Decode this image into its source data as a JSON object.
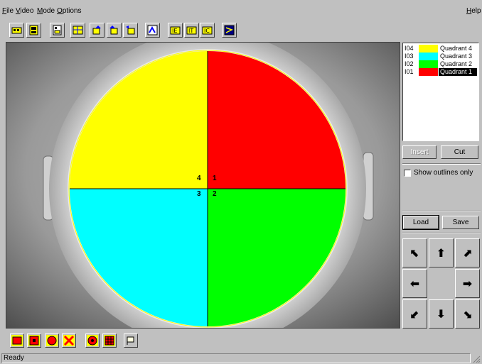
{
  "menu": {
    "items": [
      {
        "label": "File",
        "accel": "F",
        "rest": "ile"
      },
      {
        "label": "Video",
        "accel": "V",
        "rest": "ideo"
      },
      {
        "label": "Mode",
        "accel": "M",
        "rest": "ode"
      },
      {
        "label": "Options",
        "accel": "O",
        "rest": "ptions"
      }
    ],
    "help": {
      "label": "Help",
      "accel": "H",
      "rest": "elp"
    }
  },
  "toolbar": {
    "icons": [
      "camera-icon",
      "film-icon",
      "image-icon",
      "grid-icon",
      "rotate-icon",
      "rotate-alt-icon",
      "rotate-left-icon",
      "map-icon",
      "zoom-fit-icon",
      "zoom-in-icon",
      "zoom-out-icon",
      "analysis-icon"
    ]
  },
  "video": {
    "quadrant_labels": {
      "q1": "1",
      "q2": "2",
      "q3": "3",
      "q4": "4"
    },
    "colors": {
      "q1": "#ff0000",
      "q2": "#00ff00",
      "q3": "#00ffff",
      "q4": "#ffff00",
      "outline": "#ffff00"
    }
  },
  "legend": {
    "rows": [
      {
        "id": "I04",
        "color": "#ffff00",
        "name": "Quadrant 4",
        "selected": false
      },
      {
        "id": "I03",
        "color": "#00ffff",
        "name": "Quadrant 3",
        "selected": false
      },
      {
        "id": "I02",
        "color": "#00ff00",
        "name": "Quadrant 2",
        "selected": false
      },
      {
        "id": "I01",
        "color": "#ff0000",
        "name": "Quadrant 1",
        "selected": true
      }
    ]
  },
  "panel": {
    "insert_label": "Insert",
    "cut_label": "Cut",
    "show_outlines_label": "Show outlines only",
    "show_outlines_checked": false,
    "load_label": "Load",
    "save_label": "Save"
  },
  "dpad": {
    "up_left": "⬉",
    "up": "⬆",
    "up_right": "⬈",
    "left": "⬅",
    "right": "➡",
    "down_left": "⬋",
    "down": "⬇",
    "down_right": "⬊"
  },
  "bottom_toolbar": {
    "icons": [
      "rectangle-icon",
      "square-icon",
      "circle-icon",
      "cross-icon",
      "target-icon",
      "grid-icon",
      "flag-icon"
    ]
  },
  "status": {
    "text": "Ready"
  }
}
